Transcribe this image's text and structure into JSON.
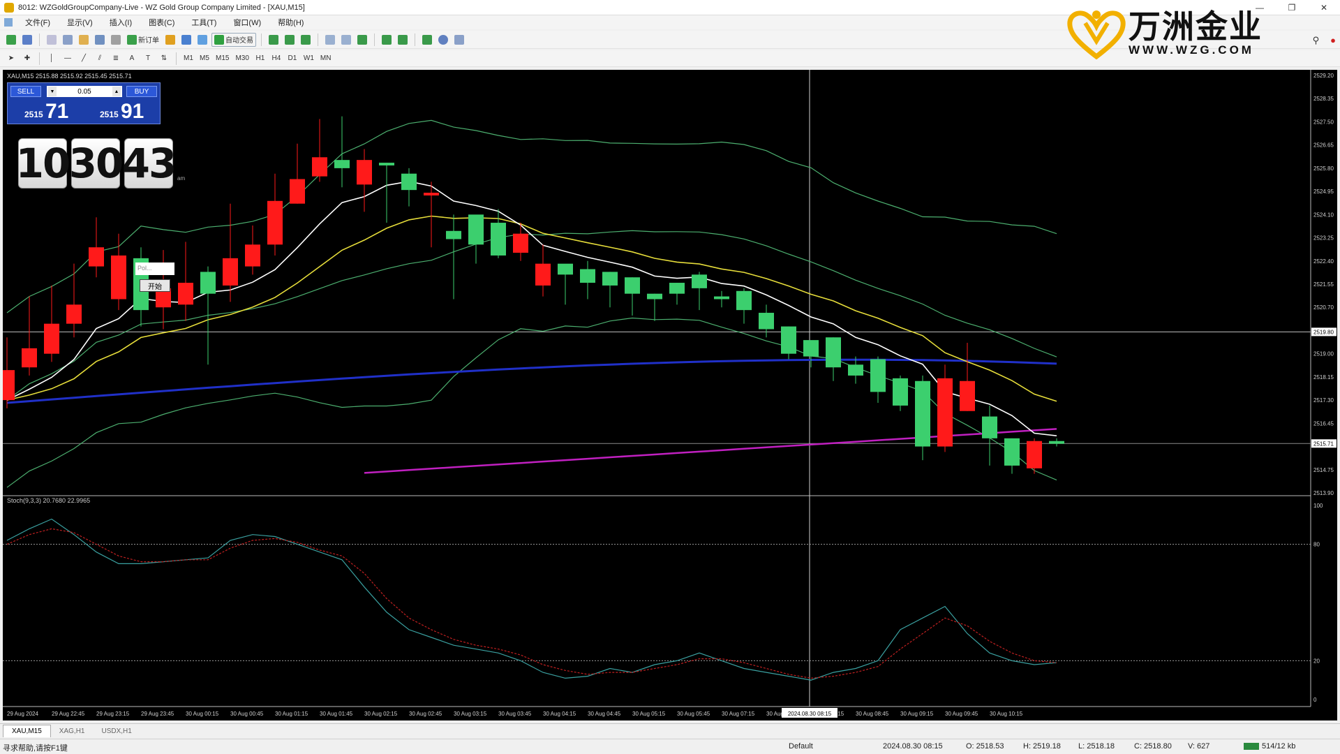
{
  "window": {
    "title": "8012: WZGoldGroupCompany-Live - WZ Gold Group Company Limited - [XAU,M15]",
    "controls": [
      "—",
      "❐",
      "✕"
    ]
  },
  "menu": [
    "文件(F)",
    "显示(V)",
    "插入(I)",
    "图表(C)",
    "工具(T)",
    "窗口(W)",
    "帮助(H)"
  ],
  "toolbar": {
    "new_order": "新订单",
    "auto_trading": "自动交易",
    "timeframes": [
      "M1",
      "M5",
      "M15",
      "M30",
      "H1",
      "H4",
      "D1",
      "W1",
      "MN"
    ]
  },
  "logo": {
    "cn": "万洲金业",
    "en": "WWW.WZG.COM"
  },
  "chart": {
    "symbol_info": "XAU,M15  2515.88 2515.92 2515.45 2515.71",
    "trade_panel": {
      "sell_label": "SELL",
      "buy_label": "BUY",
      "lot": "0.05",
      "sell_price_small": "2515",
      "sell_price_big": "71",
      "buy_price_small": "2515",
      "buy_price_big": "91"
    },
    "clock": {
      "h": "10",
      "m": "30",
      "s": "43",
      "ampm": "am"
    },
    "popup": {
      "input_placeholder": "Pol...",
      "button": "开始"
    },
    "stoch_label": "Stoch(9,3,3) 20.7680 22.9965",
    "price_axis": [
      "2529.20",
      "2528.35",
      "2527.50",
      "2526.65",
      "2525.80",
      "2524.95",
      "2524.10",
      "2523.25",
      "2522.40",
      "2521.55",
      "2520.70",
      "2519.85",
      "2519.00",
      "2518.15",
      "2517.30",
      "2516.45",
      "2515.71",
      "2514.75",
      "2513.90"
    ],
    "current_price_label": "2515.71",
    "crosshair_price": "2519.80",
    "stoch_axis": [
      "100",
      "80",
      "20",
      "0"
    ],
    "time_axis": [
      "29 Aug 2024",
      "29 Aug 22:45",
      "29 Aug 23:15",
      "29 Aug 23:45",
      "30 Aug 00:15",
      "30 Aug 00:45",
      "30 Aug 01:15",
      "30 Aug 01:45",
      "30 Aug 02:15",
      "30 Aug 02:45",
      "30 Aug 03:15",
      "30 Aug 03:45",
      "30 Aug 04:15",
      "30 Aug 04:45",
      "30 Aug 05:15",
      "30 Aug 05:45",
      "30 Aug 07:15",
      "30 Aug 07:45",
      "30 Aug 08:15",
      "30 Aug 08:45",
      "30 Aug 09:15",
      "30 Aug 09:45",
      "30 Aug 10:15"
    ],
    "crosshair_time": "2024.08.30 08:15"
  },
  "chart_data": {
    "type": "candlestick",
    "symbol": "XAU",
    "timeframe": "M15",
    "ohlc": [
      {
        "o": 2518.4,
        "h": 2519.6,
        "l": 2517.0,
        "c": 2517.3
      },
      {
        "o": 2519.2,
        "h": 2521.1,
        "l": 2518.2,
        "c": 2518.5
      },
      {
        "o": 2520.1,
        "h": 2521.5,
        "l": 2518.7,
        "c": 2519.0
      },
      {
        "o": 2520.8,
        "h": 2522.3,
        "l": 2519.6,
        "c": 2520.1
      },
      {
        "o": 2522.9,
        "h": 2524.0,
        "l": 2521.8,
        "c": 2522.2
      },
      {
        "o": 2522.6,
        "h": 2523.4,
        "l": 2520.6,
        "c": 2521.0
      },
      {
        "o": 2520.6,
        "h": 2522.9,
        "l": 2520.0,
        "c": 2522.5
      },
      {
        "o": 2521.4,
        "h": 2522.8,
        "l": 2519.9,
        "c": 2520.7
      },
      {
        "o": 2521.6,
        "h": 2523.1,
        "l": 2520.2,
        "c": 2520.8
      },
      {
        "o": 2521.2,
        "h": 2522.2,
        "l": 2518.6,
        "c": 2522.0
      },
      {
        "o": 2522.5,
        "h": 2524.5,
        "l": 2520.9,
        "c": 2521.5
      },
      {
        "o": 2523.0,
        "h": 2523.7,
        "l": 2521.9,
        "c": 2522.2
      },
      {
        "o": 2524.6,
        "h": 2525.6,
        "l": 2522.6,
        "c": 2523.0
      },
      {
        "o": 2525.4,
        "h": 2526.7,
        "l": 2524.5,
        "c": 2524.5
      },
      {
        "o": 2526.2,
        "h": 2527.6,
        "l": 2525.3,
        "c": 2525.5
      },
      {
        "o": 2525.8,
        "h": 2527.7,
        "l": 2525.1,
        "c": 2526.1
      },
      {
        "o": 2526.1,
        "h": 2526.5,
        "l": 2524.2,
        "c": 2525.2
      },
      {
        "o": 2525.9,
        "h": 2526.0,
        "l": 2523.8,
        "c": 2526.0
      },
      {
        "o": 2525.0,
        "h": 2525.8,
        "l": 2524.4,
        "c": 2525.6
      },
      {
        "o": 2524.9,
        "h": 2525.3,
        "l": 2522.9,
        "c": 2524.8
      },
      {
        "o": 2523.2,
        "h": 2524.1,
        "l": 2521.0,
        "c": 2523.5
      },
      {
        "o": 2523.0,
        "h": 2523.6,
        "l": 2522.3,
        "c": 2524.1
      },
      {
        "o": 2522.6,
        "h": 2524.3,
        "l": 2522.5,
        "c": 2523.8
      },
      {
        "o": 2523.4,
        "h": 2523.8,
        "l": 2522.4,
        "c": 2522.7
      },
      {
        "o": 2522.3,
        "h": 2523.0,
        "l": 2521.1,
        "c": 2521.5
      },
      {
        "o": 2521.9,
        "h": 2522.1,
        "l": 2520.8,
        "c": 2522.3
      },
      {
        "o": 2521.6,
        "h": 2522.4,
        "l": 2521.0,
        "c": 2522.1
      },
      {
        "o": 2521.5,
        "h": 2522.0,
        "l": 2520.7,
        "c": 2522.0
      },
      {
        "o": 2521.2,
        "h": 2521.8,
        "l": 2520.4,
        "c": 2521.8
      },
      {
        "o": 2521.0,
        "h": 2521.2,
        "l": 2520.2,
        "c": 2521.2
      },
      {
        "o": 2521.2,
        "h": 2521.6,
        "l": 2520.8,
        "c": 2521.6
      },
      {
        "o": 2521.4,
        "h": 2522.0,
        "l": 2520.6,
        "c": 2521.9
      },
      {
        "o": 2521.0,
        "h": 2521.3,
        "l": 2520.7,
        "c": 2521.1
      },
      {
        "o": 2520.6,
        "h": 2521.4,
        "l": 2520.1,
        "c": 2521.3
      },
      {
        "o": 2519.9,
        "h": 2520.8,
        "l": 2519.6,
        "c": 2520.5
      },
      {
        "o": 2519.0,
        "h": 2520.0,
        "l": 2518.8,
        "c": 2520.0
      },
      {
        "o": 2518.9,
        "h": 2519.4,
        "l": 2518.5,
        "c": 2519.5
      },
      {
        "o": 2518.5,
        "h": 2519.6,
        "l": 2518.0,
        "c": 2519.6
      },
      {
        "o": 2518.2,
        "h": 2518.9,
        "l": 2517.9,
        "c": 2518.6
      },
      {
        "o": 2517.6,
        "h": 2518.9,
        "l": 2517.2,
        "c": 2518.8
      },
      {
        "o": 2517.1,
        "h": 2518.2,
        "l": 2516.9,
        "c": 2518.1
      },
      {
        "o": 2515.6,
        "h": 2518.2,
        "l": 2515.1,
        "c": 2518.0
      },
      {
        "o": 2518.1,
        "h": 2518.6,
        "l": 2515.4,
        "c": 2515.6
      },
      {
        "o": 2518.0,
        "h": 2519.4,
        "l": 2516.9,
        "c": 2516.9
      },
      {
        "o": 2515.9,
        "h": 2517.1,
        "l": 2514.9,
        "c": 2516.7
      },
      {
        "o": 2514.9,
        "h": 2515.9,
        "l": 2514.6,
        "c": 2515.9
      },
      {
        "o": 2515.8,
        "h": 2515.9,
        "l": 2514.6,
        "c": 2514.8
      },
      {
        "o": 2515.7,
        "h": 2515.9,
        "l": 2515.6,
        "c": 2515.8
      }
    ],
    "ylim": [
      2513.9,
      2529.2
    ],
    "stoch_ylim": [
      0,
      100
    ],
    "stoch_levels": [
      80,
      20
    ],
    "stoch_main": [
      82,
      88,
      93,
      85,
      76,
      70,
      70,
      71,
      72,
      73,
      82,
      85,
      84,
      80,
      76,
      72,
      58,
      45,
      36,
      32,
      28,
      26,
      24,
      20,
      14,
      11,
      12,
      16,
      14,
      18,
      20,
      24,
      20,
      16,
      14,
      12,
      10,
      14,
      16,
      20,
      36,
      42,
      48,
      34,
      24,
      20,
      18,
      19
    ],
    "stoch_signal": [
      80,
      85,
      88,
      86,
      80,
      74,
      71,
      71,
      72,
      72,
      78,
      82,
      83,
      81,
      77,
      74,
      65,
      52,
      42,
      36,
      31,
      28,
      26,
      23,
      18,
      15,
      13,
      14,
      14,
      16,
      18,
      21,
      21,
      19,
      16,
      13,
      11,
      12,
      14,
      17,
      26,
      34,
      42,
      38,
      30,
      24,
      20,
      19
    ],
    "series_colors": {
      "bull": "#3ccf6e",
      "bear": "#ff1a1a",
      "ma_fast": "#ffffff",
      "ma_slow": "#e6dd3a",
      "ma_blue": "#2030c8",
      "ma_magenta": "#c020c0",
      "bollinger": "#4caf6f",
      "stoch_main": "#3aa0a0",
      "stoch_signal": "#c02020"
    }
  },
  "tabs": [
    "XAU,M15",
    "XAG,H1",
    "USDX,H1"
  ],
  "statusbar": {
    "help": "寻求帮助,请按F1键",
    "profile": "Default",
    "datetime": "2024.08.30 08:15",
    "open": "O: 2518.53",
    "high": "H: 2519.18",
    "low": "L: 2518.18",
    "close": "C: 2518.80",
    "volume": "V: 627",
    "traffic": "514/12 kb"
  }
}
